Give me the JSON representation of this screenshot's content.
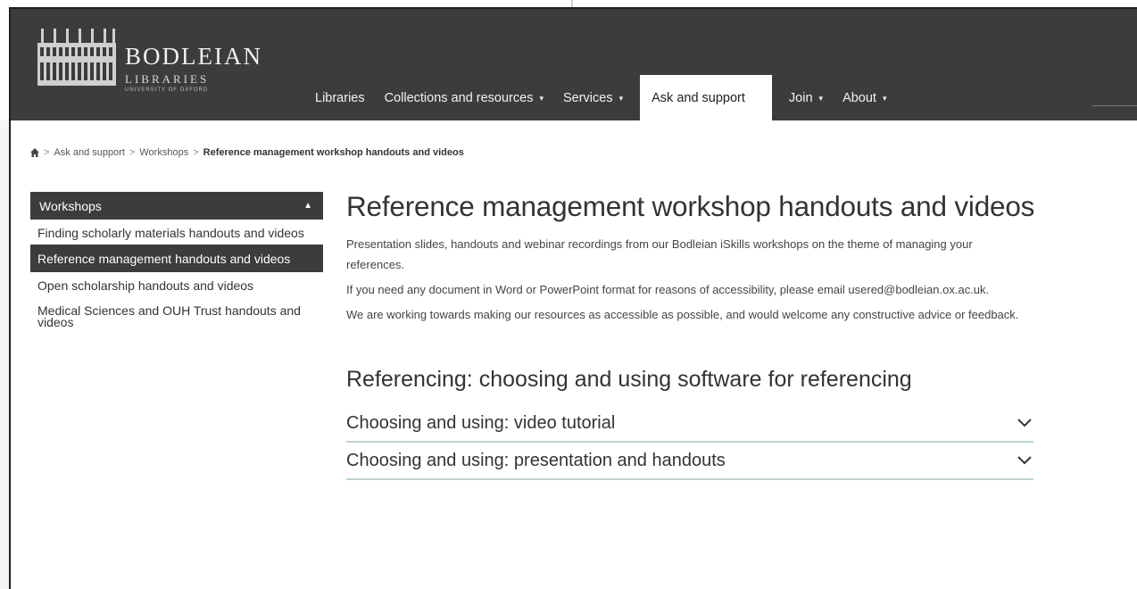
{
  "logo": {
    "line1": "BODLEIAN",
    "line2": "LIBRARIES",
    "line3": "UNIVERSITY OF OXFORD"
  },
  "nav": {
    "items": [
      {
        "label": "Libraries",
        "dropdown": false
      },
      {
        "label": "Collections and resources",
        "dropdown": true
      },
      {
        "label": "Services",
        "dropdown": true
      },
      {
        "label": "Ask and support",
        "dropdown": false,
        "active": true
      },
      {
        "label": "Join",
        "dropdown": true
      },
      {
        "label": "About",
        "dropdown": true
      }
    ],
    "caret": "▾"
  },
  "breadcrumb": {
    "home_icon": "home-icon",
    "separator": ">",
    "items": [
      "Ask and support",
      "Workshops"
    ],
    "current": "Reference management workshop handouts and videos"
  },
  "sidebar": {
    "heading": "Workshops",
    "heading_icon": "▲",
    "items": [
      {
        "label": "Finding scholarly materials handouts and videos"
      },
      {
        "label": "Reference management handouts and videos",
        "active": true
      },
      {
        "label": "Open scholarship handouts and videos"
      },
      {
        "label": "Medical Sciences and OUH Trust handouts and videos"
      }
    ]
  },
  "main": {
    "title": "Reference management workshop handouts and videos",
    "paragraphs": [
      "Presentation slides, handouts and webinar recordings from our Bodleian iSkills workshops on the theme of managing your references.",
      "If you need any document in Word or PowerPoint format for reasons of accessibility, please email usered@bodleian.ox.ac.uk.",
      "We are working towards making our resources as accessible as possible, and would welcome any constructive advice or feedback."
    ],
    "section_title": "Referencing: choosing and using software for referencing",
    "accordion": [
      {
        "label": "Choosing and using: video tutorial"
      },
      {
        "label": "Choosing and using: presentation and handouts"
      }
    ]
  },
  "colors": {
    "header_bg": "#3c3c3c",
    "accent_line": "#b9d6d1"
  }
}
